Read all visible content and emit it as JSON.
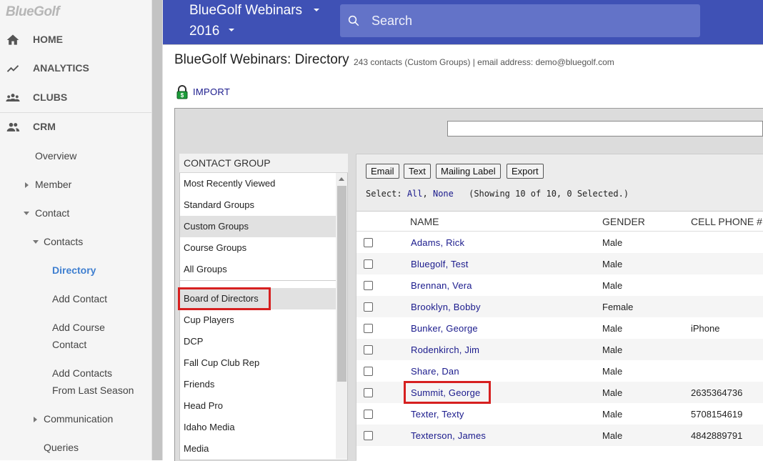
{
  "sidebar": {
    "logo": "BlueGolf",
    "top_items": [
      {
        "label": "HOME",
        "icon": "home-icon"
      },
      {
        "label": "ANALYTICS",
        "icon": "trending-icon"
      },
      {
        "label": "CLUBS",
        "icon": "group-icon"
      },
      {
        "label": "CRM",
        "icon": "people-icon"
      }
    ],
    "sub_items": {
      "overview": "Overview",
      "member": "Member",
      "contact": "Contact",
      "contacts": "Contacts",
      "directory": "Directory",
      "add_contact": "Add Contact",
      "add_course_contact_1": "Add Course",
      "add_course_contact_2": "Contact",
      "add_contacts_last_1": "Add Contacts",
      "add_contacts_last_2": "From Last Season",
      "communication": "Communication",
      "queries": "Queries"
    }
  },
  "header": {
    "title": "BlueGolf Webinars",
    "year": "2016",
    "search_placeholder": "Search"
  },
  "page": {
    "title": "BlueGolf Webinars: Directory",
    "subtitle": "243 contacts (Custom Groups) | email address: demo@bluegolf.com",
    "import_label": "IMPORT"
  },
  "contact_group": {
    "header": "CONTACT GROUP",
    "categories": [
      "Most Recently Viewed",
      "Standard Groups",
      "Custom Groups",
      "Course Groups",
      "All Groups"
    ],
    "selected_category": "Custom Groups",
    "groups": [
      "Board of Directors",
      "Cup Players",
      "DCP",
      "Fall Cup Club Rep",
      "Friends",
      "Head Pro",
      "Idaho Media",
      "Media"
    ]
  },
  "toolbar": {
    "email": "Email",
    "text": "Text",
    "mailing_label": "Mailing Label",
    "export": "Export",
    "select_label": "Select:",
    "select_all": "All",
    "select_sep": ",",
    "select_none": "None",
    "showing": "(Showing 10 of 10, 0 Selected.)"
  },
  "table": {
    "columns": [
      "NAME",
      "GENDER",
      "CELL PHONE #"
    ],
    "rows": [
      {
        "name": "Adams, Rick",
        "gender": "Male",
        "phone": ""
      },
      {
        "name": "Bluegolf, Test",
        "gender": "Male",
        "phone": ""
      },
      {
        "name": "Brennan, Vera",
        "gender": "Male",
        "phone": ""
      },
      {
        "name": "Brooklyn, Bobby",
        "gender": "Female",
        "phone": ""
      },
      {
        "name": "Bunker, George",
        "gender": "Male",
        "phone": "iPhone"
      },
      {
        "name": "Rodenkirch, Jim",
        "gender": "Male",
        "phone": ""
      },
      {
        "name": "Share, Dan",
        "gender": "Male",
        "phone": ""
      },
      {
        "name": "Summit, George",
        "gender": "Male",
        "phone": "2635364736"
      },
      {
        "name": "Texter, Texty",
        "gender": "Male",
        "phone": "5708154619"
      },
      {
        "name": "Texterson, James",
        "gender": "Male",
        "phone": "4842889791"
      }
    ]
  },
  "colors": {
    "header_bg": "#3f51b5",
    "link": "#1a1a8c",
    "active_nav": "#3f7fd0",
    "highlight": "#d62020"
  }
}
